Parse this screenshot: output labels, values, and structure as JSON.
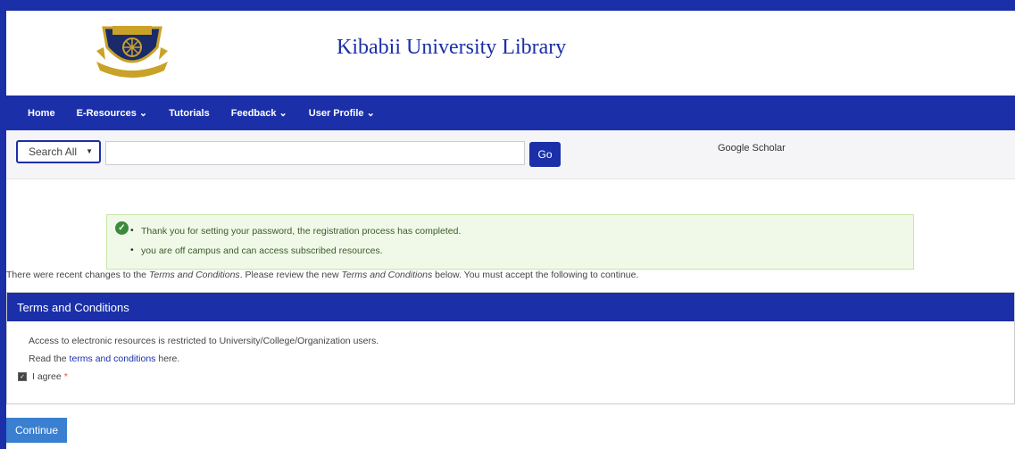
{
  "header": {
    "title": "Kibabii University Library",
    "logo_icon": "university-crest-icon"
  },
  "nav": {
    "items": [
      {
        "label": "Home"
      },
      {
        "label": "E-Resources ⌄"
      },
      {
        "label": "Tutorials"
      },
      {
        "label": "Feedback ⌄"
      },
      {
        "label": "User Profile ⌄"
      }
    ]
  },
  "search": {
    "select_value": "Search All",
    "input_value": "",
    "input_placeholder": "",
    "go_label": "Go",
    "scholar_label": "Google Scholar"
  },
  "alert": {
    "icon": "check-circle-icon",
    "messages": [
      "Thank you for setting your password, the registration process has completed.",
      "you are off campus and can access subscribed resources."
    ]
  },
  "notice": {
    "part1": "There were recent changes to the ",
    "em1": "Terms and Conditions",
    "part2": ". Please review the new ",
    "em2": "Terms and Conditions",
    "part3": " below. You must accept the following to continue."
  },
  "terms_panel": {
    "heading": "Terms and Conditions",
    "line1": "Access to electronic resources is restricted to University/College/Organization users.",
    "line2_prefix": "Read the ",
    "line2_link": "terms and conditions",
    "line2_suffix": " here.",
    "agree_label": "I agree",
    "agree_required": "*",
    "agree_checked": true
  },
  "continue_label": "Continue",
  "colors": {
    "primary": "#1a2fa8",
    "alert_bg": "#f0f9e8",
    "continue_bg": "#3a7fd0"
  }
}
